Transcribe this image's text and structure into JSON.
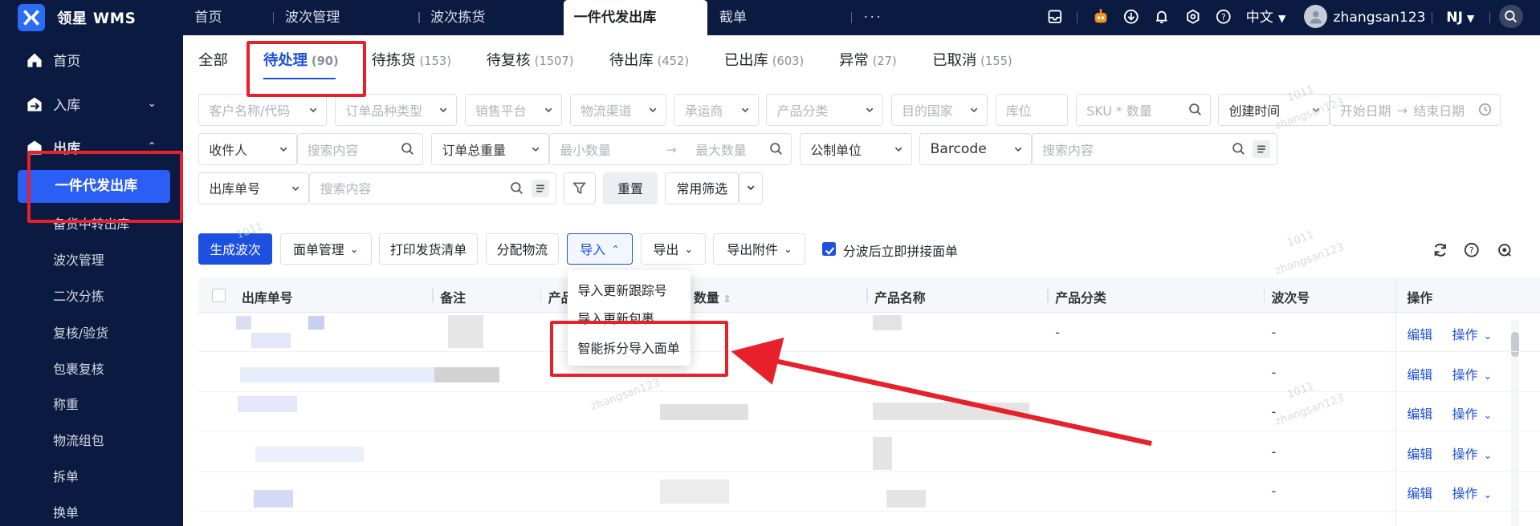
{
  "app": {
    "brand": "领星 WMS",
    "brand_color": "#0b1a40",
    "accent": "#1d4fe0"
  },
  "top_tabs": [
    {
      "label": "首页"
    },
    {
      "label": "波次管理"
    },
    {
      "label": "波次拣货"
    },
    {
      "label": "一件代发出库",
      "active": true
    },
    {
      "label": "截单"
    },
    {
      "label": "···"
    }
  ],
  "header": {
    "language": "中文",
    "username": "zhangsan123",
    "warehouse": "NJ",
    "icons": [
      "inbox-icon",
      "robot-icon",
      "download-icon",
      "bell-icon",
      "settings-icon",
      "help-icon",
      "avatar-icon",
      "search-icon"
    ]
  },
  "sidebar": {
    "items": [
      {
        "label": "首页",
        "icon": "home-icon"
      },
      {
        "label": "入库",
        "icon": "inbound-icon",
        "arrow": "⌄"
      },
      {
        "label": "出库",
        "icon": "outbound-icon",
        "arrow": "⌃"
      }
    ],
    "sub_items": [
      "一件代发出库",
      "备货中转出库",
      "波次管理",
      "二次分拣",
      "复核/验货",
      "包裹复核",
      "称重",
      "物流组包",
      "拆单",
      "换单"
    ]
  },
  "status_tabs": [
    {
      "label": "全部",
      "count": ""
    },
    {
      "label": "待处理",
      "count": "(90)",
      "active": true
    },
    {
      "label": "待拣货",
      "count": "(153)"
    },
    {
      "label": "待复核",
      "count": "(1507)"
    },
    {
      "label": "待出库",
      "count": "(452)"
    },
    {
      "label": "已出库",
      "count": "(603)"
    },
    {
      "label": "异常",
      "count": "(27)"
    },
    {
      "label": "已取消",
      "count": "(155)"
    }
  ],
  "filters": {
    "row1": [
      "客户名称/代码",
      "订单品种类型",
      "销售平台",
      "物流渠道",
      "承运商",
      "产品分类",
      "目的国家",
      "库位",
      "SKU * 数量",
      "创建时间",
      "开始日期",
      "结束日期"
    ],
    "row2": {
      "recipient": "收件人",
      "search_placeholder": "搜索内容",
      "weight": "订单总重量",
      "min": "最小数量",
      "max": "最大数量",
      "unit": "公制单位",
      "barcode": "Barcode",
      "search2_placeholder": "搜索内容"
    },
    "row3": {
      "field": "出库单号",
      "search_placeholder": "搜索内容",
      "reset": "重置",
      "common": "常用筛选"
    }
  },
  "toolbar": {
    "generate": "生成波次",
    "face_sheet": "面单管理",
    "print_list": "打印发货清单",
    "assign_logistics": "分配物流",
    "import": "导入",
    "export": "导出",
    "export_attach": "导出附件",
    "checkbox_label": "分波后立即拼接面单"
  },
  "import_menu": [
    "导入更新跟踪号",
    "导入更新包裹",
    "智能拆分导入面单"
  ],
  "table": {
    "headers": [
      "出库单号",
      "备注",
      "产品",
      "数量",
      "产品名称",
      "产品分类",
      "波次号",
      "操作"
    ],
    "rows": [
      {
        "category": "-",
        "wave": "-",
        "edit": "编辑",
        "op": "操作"
      },
      {
        "category": "",
        "wave": "-",
        "edit": "编辑",
        "op": "操作"
      },
      {
        "category": "",
        "wave": "-",
        "edit": "编辑",
        "op": "操作"
      },
      {
        "category": "",
        "wave": "-",
        "edit": "编辑",
        "op": "操作"
      },
      {
        "category": "",
        "wave": "-",
        "edit": "编辑",
        "op": "操作"
      }
    ]
  },
  "watermark": [
    "1011",
    "zhangsan123"
  ]
}
